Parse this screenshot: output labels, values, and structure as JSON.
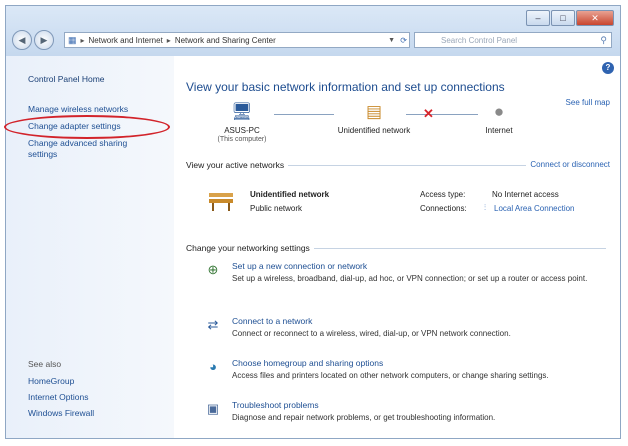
{
  "window": {
    "buttons": {
      "minimize": "–",
      "maximize": "□",
      "close": "✕"
    }
  },
  "toolbar": {
    "back": "◀",
    "forward": "▶",
    "breadcrumb": [
      "Network and Internet",
      "Network and Sharing Center"
    ],
    "breadcrumb_sep": "▸",
    "search_placeholder": "Search Control Panel"
  },
  "left_pane": {
    "home": "Control Panel Home",
    "links": [
      "Manage wireless networks",
      "Change adapter settings",
      "Change advanced sharing settings"
    ],
    "see_also_label": "See also",
    "see_also": [
      "HomeGroup",
      "Internet Options",
      "Windows Firewall"
    ]
  },
  "main": {
    "heading": "View your basic network information and set up connections",
    "see_full_map": "See full map",
    "map": {
      "computer": {
        "name": "ASUS-PC",
        "sub": "(This computer)"
      },
      "network": {
        "name": "Unidentified network"
      },
      "internet": {
        "name": "Internet"
      }
    },
    "active_networks_label": "View your active networks",
    "connect_disconnect": "Connect or disconnect",
    "active_network": {
      "name": "Unidentified network",
      "type": "Public network",
      "access_type_label": "Access type:",
      "access_type_value": "No Internet access",
      "connections_label": "Connections:",
      "connections_value": "Local Area Connection"
    },
    "change_settings_label": "Change your networking settings",
    "tasks": [
      {
        "link": "Set up a new connection or network",
        "desc": "Set up a wireless, broadband, dial-up, ad hoc, or VPN connection; or set up a router or access point."
      },
      {
        "link": "Connect to a network",
        "desc": "Connect or reconnect to a wireless, wired, dial-up, or VPN network connection."
      },
      {
        "link": "Choose homegroup and sharing options",
        "desc": "Access files and printers located on other network computers, or change sharing settings."
      },
      {
        "link": "Troubleshoot problems",
        "desc": "Diagnose and repair network problems, or get troubleshooting information."
      }
    ]
  },
  "colors": {
    "link": "#1e4f93",
    "error_x": "#d7242b",
    "highlight_circle": "#d2232a"
  }
}
